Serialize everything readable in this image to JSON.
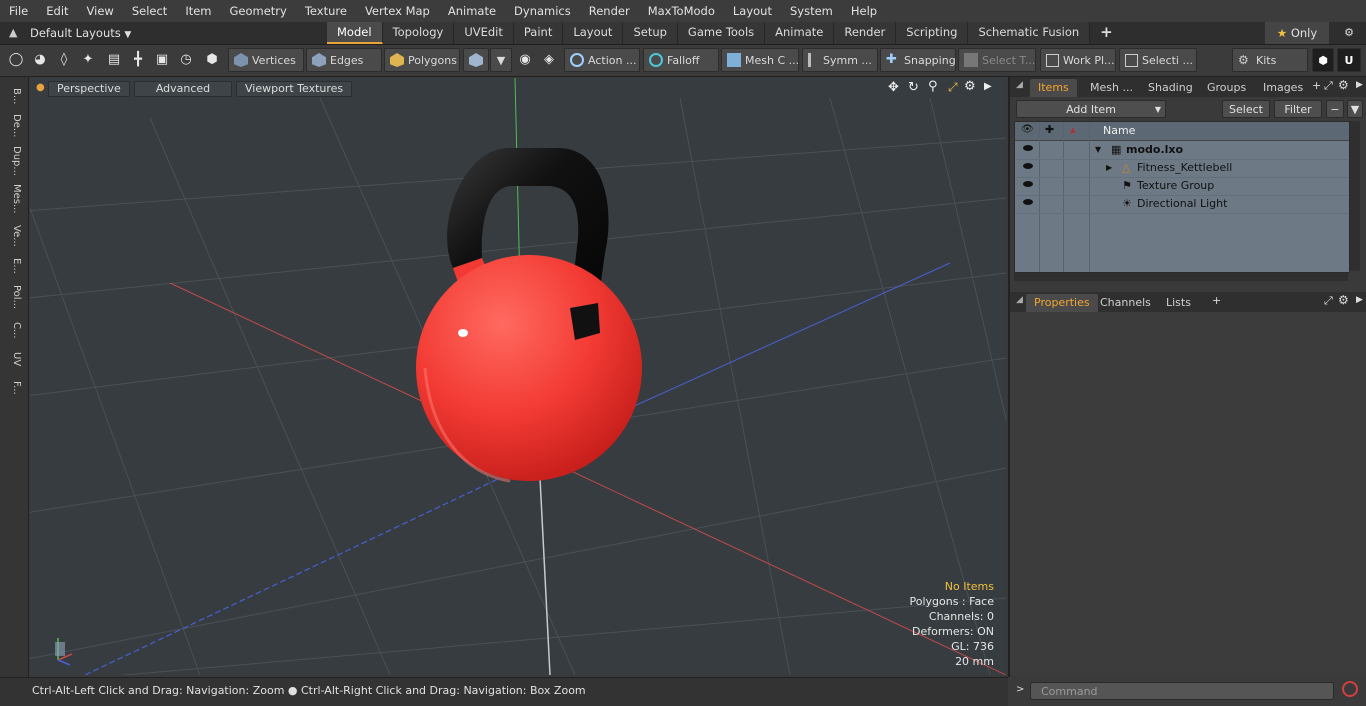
{
  "menu": [
    "File",
    "Edit",
    "View",
    "Select",
    "Item",
    "Geometry",
    "Texture",
    "Vertex Map",
    "Animate",
    "Dynamics",
    "Render",
    "MaxToModo",
    "Layout",
    "System",
    "Help"
  ],
  "layout": {
    "dropdown_label": "Default Layouts",
    "tabs": [
      "Model",
      "Topology",
      "UVEdit",
      "Paint",
      "Layout",
      "Setup",
      "Game Tools",
      "Animate",
      "Render",
      "Scripting",
      "Schematic Fusion"
    ],
    "active_tab": "Model",
    "add_tab": "+",
    "only_label": "Only"
  },
  "toolbar": {
    "vertices": "Vertices",
    "edges": "Edges",
    "polygons": "Polygons",
    "action": "Action ...",
    "falloff": "Falloff",
    "mesh": "Mesh C ...",
    "symm": "Symm ...",
    "snapping": "Snapping",
    "select_t": "Select T...",
    "work_plane": "Work Pl...",
    "selecti": "Selecti ...",
    "kits": "Kits"
  },
  "left_strip": [
    "B...",
    "De...",
    "Dup...",
    "Mes...",
    "Ve...",
    "E...",
    "Pol...",
    "C...",
    "UV",
    "F..."
  ],
  "viewport": {
    "perspective": "Perspective",
    "advanced": "Advanced",
    "viewport_textures": "Viewport Textures",
    "info": {
      "no_items": "No Items",
      "polygons": "Polygons : Face",
      "channels": "Channels: 0",
      "deformers": "Deformers: ON",
      "gl": "GL: 736",
      "scale": "20 mm"
    }
  },
  "status": {
    "text": "Ctrl-Alt-Left Click and Drag: Navigation: Zoom ● Ctrl-Alt-Right Click and Drag: Navigation: Box Zoom"
  },
  "right_panel": {
    "top_tabs": [
      "Items",
      "Mesh ...",
      "Shading",
      "Groups",
      "Images"
    ],
    "add_item": "Add Item",
    "select": "Select",
    "filter": "Filter",
    "tree_header": "Name",
    "tree": [
      {
        "label": "modo.lxo"
      },
      {
        "label": "Fitness_Kettlebell"
      },
      {
        "label": "Texture Group"
      },
      {
        "label": "Directional Light"
      }
    ],
    "bottom_tabs": [
      "Properties",
      "Channels",
      "Lists"
    ],
    "command_placeholder": "Command"
  },
  "colors": {
    "accent": "#e8a33a",
    "kettlebell_body": "#f23a33",
    "kettlebell_handle": "#111111"
  }
}
